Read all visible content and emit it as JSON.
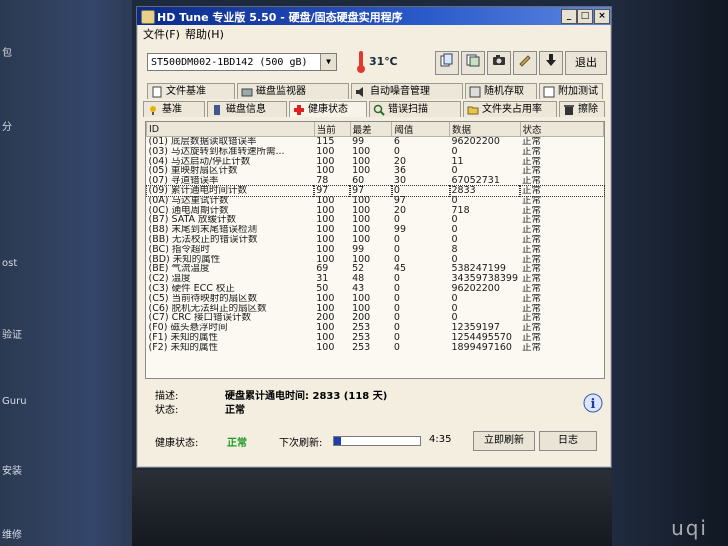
{
  "desktop": {
    "left_labels": [
      "包",
      "分",
      "ost",
      "验证",
      "Guru",
      "安装",
      "维修"
    ],
    "watermark": "uqi"
  },
  "window": {
    "title": "HD Tune 专业版 5.50 - 硬盘/固态硬盘实用程序",
    "menu": [
      "文件(F)",
      "帮助(H)"
    ],
    "controls": {
      "minimize": "_",
      "maximize": "□",
      "close": "×"
    }
  },
  "toolbar": {
    "drive": "ST500DM002-1BD142 (500 gB)",
    "temperature": "31℃",
    "buttons": [
      "copy-info-icon",
      "copy-screenshot-icon",
      "camera-icon",
      "options-icon",
      "download-icon"
    ],
    "exit_label": "退出"
  },
  "tabs": {
    "row1": [
      {
        "label": "文件基准",
        "icon": "file-benchmark-icon"
      },
      {
        "label": "磁盘监视器",
        "icon": "disk-monitor-icon"
      },
      {
        "label": "自动噪音管理",
        "icon": "speaker-icon"
      },
      {
        "label": "随机存取",
        "icon": "random-access-icon"
      },
      {
        "label": "附加测试",
        "icon": "extra-tests-icon"
      }
    ],
    "row2": [
      {
        "label": "基准",
        "icon": "benchmark-icon"
      },
      {
        "label": "磁盘信息",
        "icon": "disk-info-icon"
      },
      {
        "label": "健康状态",
        "icon": "health-icon"
      },
      {
        "label": "错误扫描",
        "icon": "error-scan-icon"
      },
      {
        "label": "文件夹占用率",
        "icon": "folder-usage-icon"
      },
      {
        "label": "擦除",
        "icon": "erase-icon"
      }
    ],
    "active": "健康状态"
  },
  "table": {
    "headers": [
      "ID",
      "当前",
      "最差",
      "阈值",
      "数据",
      "状态"
    ],
    "rows": [
      [
        "(01) 底层数据读取错误率",
        "115",
        "99",
        "6",
        "96202200",
        "正常"
      ],
      [
        "(03) 马达旋转到标准转速所需...",
        "100",
        "100",
        "0",
        "0",
        "正常"
      ],
      [
        "(04) 马达启动/停止计数",
        "100",
        "100",
        "20",
        "11",
        "正常"
      ],
      [
        "(05) 重映射扇区计数",
        "100",
        "100",
        "36",
        "0",
        "正常"
      ],
      [
        "(07) 寻道错误率",
        "78",
        "60",
        "30",
        "67052731",
        "正常"
      ],
      [
        "(09) 累计通电时间计数",
        "97",
        "97",
        "0",
        "2833",
        "正常"
      ],
      [
        "(0A) 马达重试计数",
        "100",
        "100",
        "97",
        "0",
        "正常"
      ],
      [
        "(0C) 通电周期计数",
        "100",
        "100",
        "20",
        "718",
        "正常"
      ],
      [
        "(B7) SATA 放缓计数",
        "100",
        "100",
        "0",
        "0",
        "正常"
      ],
      [
        "(B8) 末尾到末尾错误检测",
        "100",
        "100",
        "99",
        "0",
        "正常"
      ],
      [
        "(BB) 无法校正的错误计数",
        "100",
        "100",
        "0",
        "0",
        "正常"
      ],
      [
        "(BC) 指令超时",
        "100",
        "99",
        "0",
        "8",
        "正常"
      ],
      [
        "(BD) 未知的属性",
        "100",
        "100",
        "0",
        "0",
        "正常"
      ],
      [
        "(BE) 气流温度",
        "69",
        "52",
        "45",
        "538247199",
        "正常"
      ],
      [
        "(C2) 温度",
        "31",
        "48",
        "0",
        "34359738399",
        "正常"
      ],
      [
        "(C3) 硬件 ECC 校正",
        "50",
        "43",
        "0",
        "96202200",
        "正常"
      ],
      [
        "(C5) 当前待映射的扇区数",
        "100",
        "100",
        "0",
        "0",
        "正常"
      ],
      [
        "(C6) 脱机无法纠正的扇区数",
        "100",
        "100",
        "0",
        "0",
        "正常"
      ],
      [
        "(C7) CRC 接口错误计数",
        "200",
        "200",
        "0",
        "0",
        "正常"
      ],
      [
        "(F0) 磁头悬浮时间",
        "100",
        "253",
        "0",
        "12359197",
        "正常"
      ],
      [
        "(F1) 未知的属性",
        "100",
        "253",
        "0",
        "1254495570",
        "正常"
      ],
      [
        "(F2) 未知的属性",
        "100",
        "253",
        "0",
        "1899497160",
        "正常"
      ]
    ],
    "selected_row": 5
  },
  "details": {
    "desc_label": "描述:",
    "desc_value": "硬盘累计通电时间: 2833 (118 天)",
    "status_label": "状态:",
    "status_value": "正常"
  },
  "statusbar": {
    "health_label": "健康状态:",
    "health_value": "正常",
    "health_color": "#1f9a2a",
    "next_refresh_label": "下次刷新:",
    "refresh_progress": 0.08,
    "countdown": "4:35",
    "refresh_button": "立即刷新",
    "log_button": "日志"
  }
}
